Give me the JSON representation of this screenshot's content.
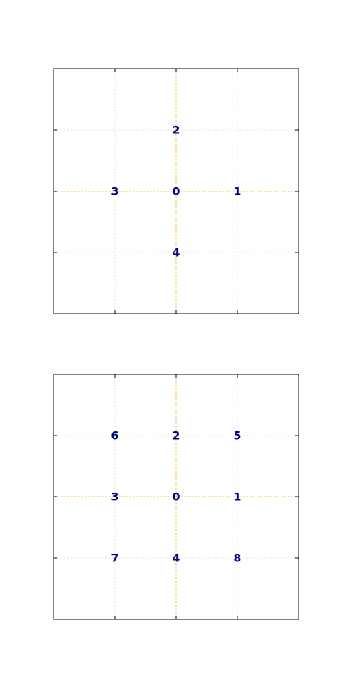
{
  "colors": {
    "label": "#000080",
    "center_lines": "#ffa500",
    "grid": "#d9d9d9",
    "frame": "#000000"
  },
  "panels": [
    {
      "xlim": [
        -2,
        2
      ],
      "ylim": [
        -2,
        2
      ],
      "ticks": [
        -1,
        0,
        1
      ],
      "nodes": [
        {
          "label": "0",
          "x": 0,
          "y": 0
        },
        {
          "label": "1",
          "x": 1,
          "y": 0
        },
        {
          "label": "2",
          "x": 0,
          "y": 1
        },
        {
          "label": "3",
          "x": -1,
          "y": 0
        },
        {
          "label": "4",
          "x": 0,
          "y": -1
        }
      ]
    },
    {
      "xlim": [
        -2,
        2
      ],
      "ylim": [
        -2,
        2
      ],
      "ticks": [
        -1,
        0,
        1
      ],
      "nodes": [
        {
          "label": "0",
          "x": 0,
          "y": 0
        },
        {
          "label": "1",
          "x": 1,
          "y": 0
        },
        {
          "label": "2",
          "x": 0,
          "y": 1
        },
        {
          "label": "3",
          "x": -1,
          "y": 0
        },
        {
          "label": "4",
          "x": 0,
          "y": -1
        },
        {
          "label": "5",
          "x": 1,
          "y": 1
        },
        {
          "label": "6",
          "x": -1,
          "y": 1
        },
        {
          "label": "7",
          "x": -1,
          "y": -1
        },
        {
          "label": "8",
          "x": 1,
          "y": -1
        }
      ]
    }
  ]
}
